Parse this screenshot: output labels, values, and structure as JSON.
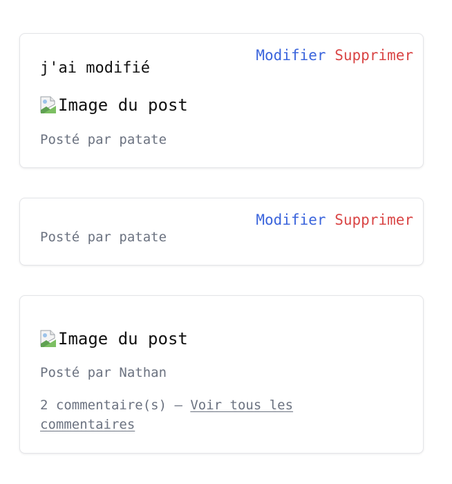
{
  "posts": [
    {
      "title": "j'ai modifié",
      "image_alt": "Image du post",
      "author_line": "Posté par patate",
      "actions": {
        "edit": "Modifier",
        "delete": "Supprimer"
      }
    },
    {
      "author_line": "Posté par patate",
      "actions": {
        "edit": "Modifier",
        "delete": "Supprimer"
      }
    },
    {
      "image_alt": "Image du post",
      "author_line": "Posté par Nathan",
      "comments_count": "2 commentaire(s) — ",
      "comments_link": "Voir tous les commentaires"
    }
  ],
  "colors": {
    "edit": "#3a64dc",
    "delete": "#d94545",
    "meta": "#6b7280"
  },
  "icons": {
    "broken_image": "broken-image-icon"
  }
}
